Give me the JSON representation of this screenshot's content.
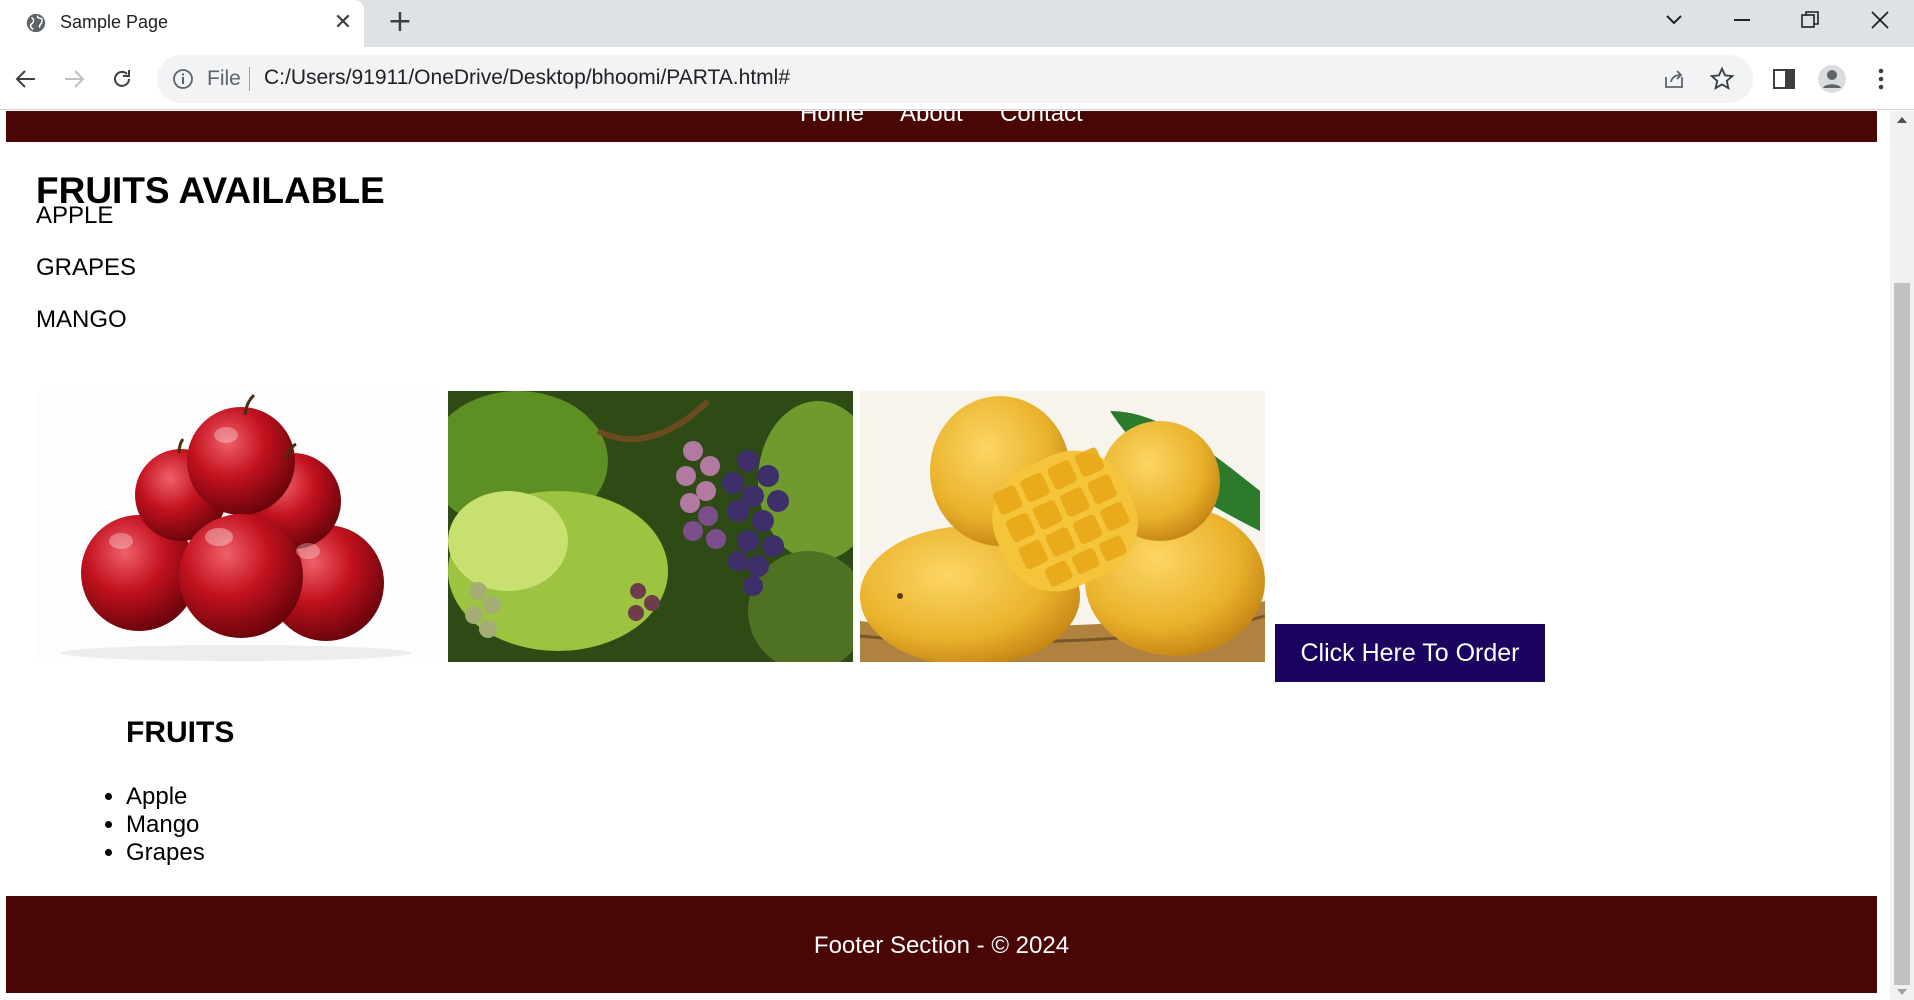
{
  "browser": {
    "tab_title": "Sample Page",
    "tab_icon": "globe-icon",
    "address_scheme_label": "File",
    "url": "C:/Users/91911/OneDrive/Desktop/bhoomi/PARTA.html#"
  },
  "nav": {
    "links": [
      "Home",
      "About",
      "Contact"
    ]
  },
  "main": {
    "heading": "FRUITS AVAILABLE",
    "fruit_lines": [
      "APPLE",
      "GRAPES",
      "MANGO"
    ],
    "images": [
      "apple-image",
      "grapes-image",
      "mango-image"
    ],
    "order_button_label": "Click Here To Order",
    "sub_heading": "FRUITS",
    "list_items": [
      "Apple",
      "Mango",
      "Grapes"
    ]
  },
  "footer": {
    "text": "Footer Section - © 2024"
  },
  "colors": {
    "header_footer_bg": "#4a0505",
    "button_bg": "#1a0460"
  }
}
